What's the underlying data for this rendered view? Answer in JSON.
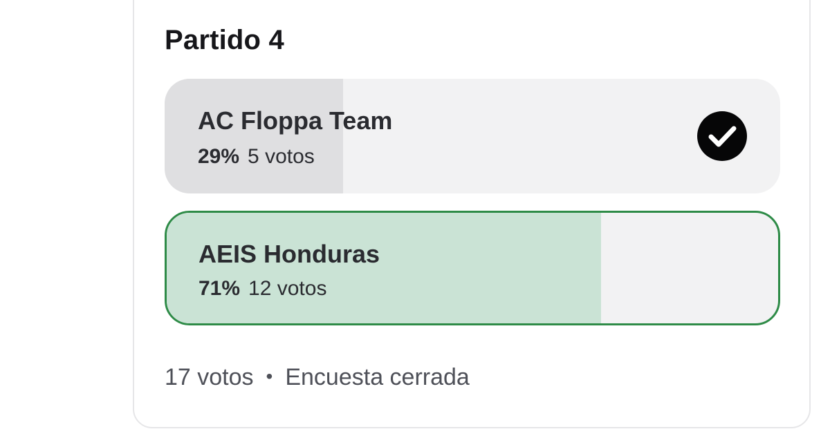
{
  "poll": {
    "title": "Partido 4",
    "options": [
      {
        "label": "AC Floppa Team",
        "percent": "29%",
        "votes": "5 votos",
        "fill_fraction": 0.29,
        "selected_by_user": true,
        "winner": false
      },
      {
        "label": "AEIS Honduras",
        "percent": "71%",
        "votes": "12 votos",
        "fill_fraction": 0.71,
        "selected_by_user": false,
        "winner": true
      }
    ],
    "footer": {
      "total_votes": "17 votos",
      "separator": "•",
      "status": "Encuesta cerrada"
    }
  },
  "colors": {
    "winner_border": "#2e8b47",
    "winner_fill": "#cae3d5",
    "neutral_fill": "#dfdfe1",
    "track": "#f2f2f3",
    "check_bg": "#060607"
  }
}
